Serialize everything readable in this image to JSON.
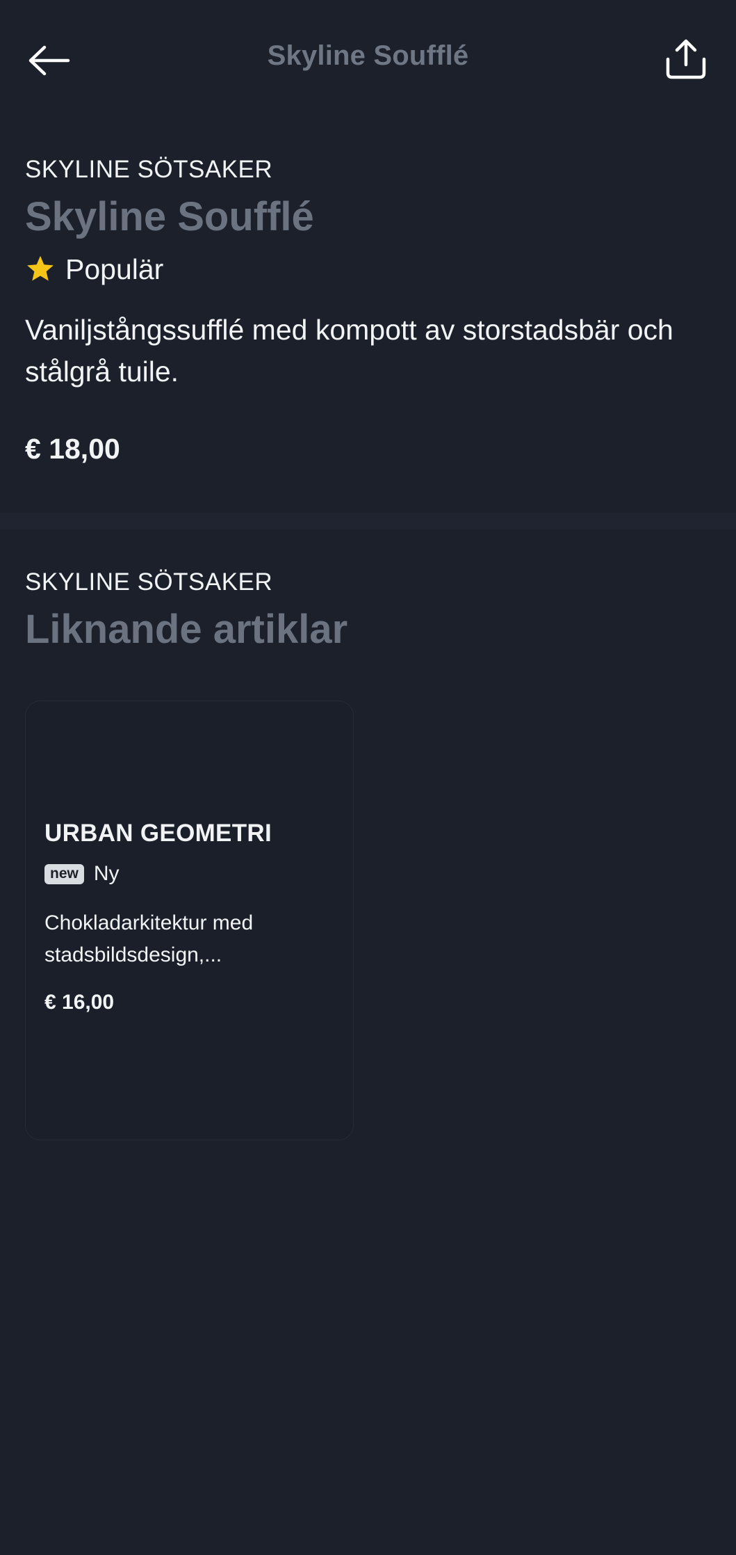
{
  "header": {
    "title": "Skyline Soufflé",
    "back_icon": "arrow-left-icon",
    "share_icon": "share-icon"
  },
  "product": {
    "brand": "SKYLINE SÖTSAKER",
    "name": "Skyline Soufflé",
    "badge_icon": "star-icon",
    "badge_label": "Populär",
    "description": "Vaniljstångssufflé med kompott av storstadsbär och stålgrå tuile.",
    "price": "€ 18,00"
  },
  "related": {
    "brand": "SKYLINE SÖTSAKER",
    "heading": "Liknande artiklar",
    "items": [
      {
        "title": "URBAN GEOMETRI",
        "badge": "new",
        "badge_label": "Ny",
        "description": "Chokladarkitektur med stadsbildsdesign,...",
        "price": "€ 16,00"
      }
    ]
  },
  "colors": {
    "background": "#1b202b",
    "muted_title": "#6b7380",
    "star": "#f5c518",
    "text": "#f2f3f5"
  }
}
